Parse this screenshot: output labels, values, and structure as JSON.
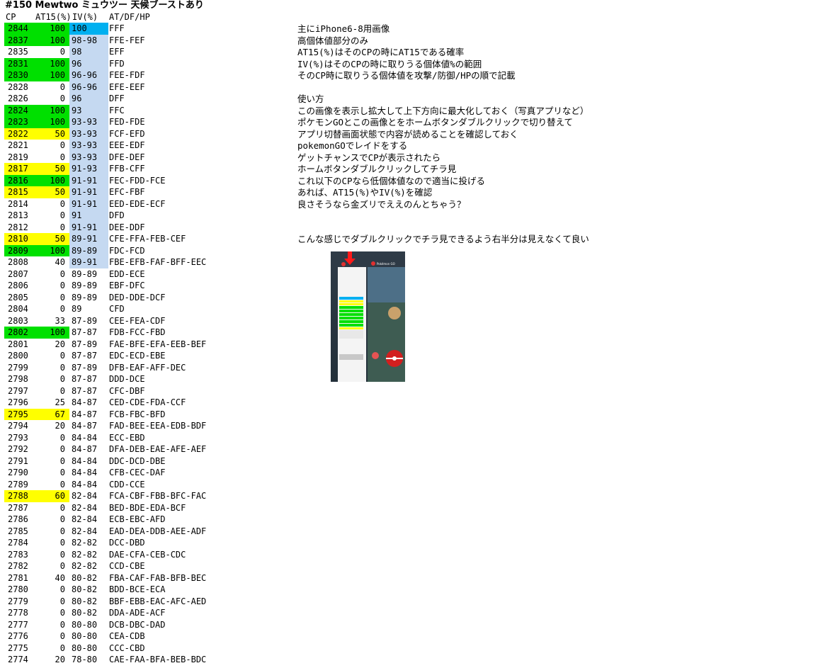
{
  "title": "#150 Mewtwo ミュウツー 天候ブーストあり",
  "headers": {
    "cp": "CP",
    "at": "AT15(%)",
    "iv": "IV(%)",
    "vals": "AT/DF/HP"
  },
  "rows": [
    {
      "cp": "2844",
      "at": "100",
      "iv": "100",
      "vals": "FFF"
    },
    {
      "cp": "2837",
      "at": "100",
      "iv": "98-98",
      "vals": "FFE-FEF"
    },
    {
      "cp": "2835",
      "at": "0",
      "iv": "98",
      "vals": "EFF"
    },
    {
      "cp": "2831",
      "at": "100",
      "iv": "96",
      "vals": "FFD"
    },
    {
      "cp": "2830",
      "at": "100",
      "iv": "96-96",
      "vals": "FEE-FDF"
    },
    {
      "cp": "2828",
      "at": "0",
      "iv": "96-96",
      "vals": "EFE-EEF"
    },
    {
      "cp": "2826",
      "at": "0",
      "iv": "96",
      "vals": "DFF"
    },
    {
      "cp": "2824",
      "at": "100",
      "iv": "93",
      "vals": "FFC"
    },
    {
      "cp": "2823",
      "at": "100",
      "iv": "93-93",
      "vals": "FED-FDE"
    },
    {
      "cp": "2822",
      "at": "50",
      "iv": "93-93",
      "vals": "FCF-EFD"
    },
    {
      "cp": "2821",
      "at": "0",
      "iv": "93-93",
      "vals": "EEE-EDF"
    },
    {
      "cp": "2819",
      "at": "0",
      "iv": "93-93",
      "vals": "DFE-DEF"
    },
    {
      "cp": "2817",
      "at": "50",
      "iv": "91-93",
      "vals": "FFB-CFF"
    },
    {
      "cp": "2816",
      "at": "100",
      "iv": "91-91",
      "vals": "FEC-FDD-FCE"
    },
    {
      "cp": "2815",
      "at": "50",
      "iv": "91-91",
      "vals": "EFC-FBF"
    },
    {
      "cp": "2814",
      "at": "0",
      "iv": "91-91",
      "vals": "EED-EDE-ECF"
    },
    {
      "cp": "2813",
      "at": "0",
      "iv": "91",
      "vals": "DFD"
    },
    {
      "cp": "2812",
      "at": "0",
      "iv": "91-91",
      "vals": "DEE-DDF"
    },
    {
      "cp": "2810",
      "at": "50",
      "iv": "89-91",
      "vals": "CFE-FFA-FEB-CEF"
    },
    {
      "cp": "2809",
      "at": "100",
      "iv": "89-89",
      "vals": "FDC-FCD"
    },
    {
      "cp": "2808",
      "at": "40",
      "iv": "89-91",
      "vals": "FBE-EFB-FAF-BFF-EEC"
    },
    {
      "cp": "2807",
      "at": "0",
      "iv": "89-89",
      "vals": "EDD-ECE"
    },
    {
      "cp": "2806",
      "at": "0",
      "iv": "89-89",
      "vals": "EBF-DFC"
    },
    {
      "cp": "2805",
      "at": "0",
      "iv": "89-89",
      "vals": "DED-DDE-DCF"
    },
    {
      "cp": "2804",
      "at": "0",
      "iv": "89",
      "vals": "CFD"
    },
    {
      "cp": "2803",
      "at": "33",
      "iv": "87-89",
      "vals": "CEE-FEA-CDF"
    },
    {
      "cp": "2802",
      "at": "100",
      "iv": "87-87",
      "vals": "FDB-FCC-FBD"
    },
    {
      "cp": "2801",
      "at": "20",
      "iv": "87-89",
      "vals": "FAE-BFE-EFA-EEB-BEF"
    },
    {
      "cp": "2800",
      "at": "0",
      "iv": "87-87",
      "vals": "EDC-ECD-EBE"
    },
    {
      "cp": "2799",
      "at": "0",
      "iv": "87-89",
      "vals": "DFB-EAF-AFF-DEC"
    },
    {
      "cp": "2798",
      "at": "0",
      "iv": "87-87",
      "vals": "DDD-DCE"
    },
    {
      "cp": "2797",
      "at": "0",
      "iv": "87-87",
      "vals": "CFC-DBF"
    },
    {
      "cp": "2796",
      "at": "25",
      "iv": "84-87",
      "vals": "CED-CDE-FDA-CCF"
    },
    {
      "cp": "2795",
      "at": "67",
      "iv": "84-87",
      "vals": "FCB-FBC-BFD"
    },
    {
      "cp": "2794",
      "at": "20",
      "iv": "84-87",
      "vals": "FAD-BEE-EEA-EDB-BDF"
    },
    {
      "cp": "2793",
      "at": "0",
      "iv": "84-84",
      "vals": "ECC-EBD"
    },
    {
      "cp": "2792",
      "at": "0",
      "iv": "84-87",
      "vals": "DFA-DEB-EAE-AFE-AEF"
    },
    {
      "cp": "2791",
      "at": "0",
      "iv": "84-84",
      "vals": "DDC-DCD-DBE"
    },
    {
      "cp": "2790",
      "at": "0",
      "iv": "84-84",
      "vals": "CFB-CEC-DAF"
    },
    {
      "cp": "2789",
      "at": "0",
      "iv": "84-84",
      "vals": "CDD-CCE"
    },
    {
      "cp": "2788",
      "at": "60",
      "iv": "82-84",
      "vals": "FCA-CBF-FBB-BFC-FAC"
    },
    {
      "cp": "2787",
      "at": "0",
      "iv": "82-84",
      "vals": "BED-BDE-EDA-BCF"
    },
    {
      "cp": "2786",
      "at": "0",
      "iv": "82-84",
      "vals": "ECB-EBC-AFD"
    },
    {
      "cp": "2785",
      "at": "0",
      "iv": "82-84",
      "vals": "EAD-DEA-DDB-AEE-ADF"
    },
    {
      "cp": "2784",
      "at": "0",
      "iv": "82-82",
      "vals": "DCC-DBD"
    },
    {
      "cp": "2783",
      "at": "0",
      "iv": "82-82",
      "vals": "DAE-CFA-CEB-CDC"
    },
    {
      "cp": "2782",
      "at": "0",
      "iv": "82-82",
      "vals": "CCD-CBE"
    },
    {
      "cp": "2781",
      "at": "40",
      "iv": "80-82",
      "vals": "FBA-CAF-FAB-BFB-BEC"
    },
    {
      "cp": "2780",
      "at": "0",
      "iv": "80-82",
      "vals": "BDD-BCE-ECA"
    },
    {
      "cp": "2779",
      "at": "0",
      "iv": "80-82",
      "vals": "BBF-EBB-EAC-AFC-AED"
    },
    {
      "cp": "2778",
      "at": "0",
      "iv": "80-82",
      "vals": "DDA-ADE-ACF"
    },
    {
      "cp": "2777",
      "at": "0",
      "iv": "80-80",
      "vals": "DCB-DBC-DAD"
    },
    {
      "cp": "2776",
      "at": "0",
      "iv": "80-80",
      "vals": "CEA-CDB"
    },
    {
      "cp": "2775",
      "at": "0",
      "iv": "80-80",
      "vals": "CCC-CBD"
    },
    {
      "cp": "2774",
      "at": "20",
      "iv": "78-80",
      "vals": "CAE-FAA-BFA-BEB-BDC"
    }
  ],
  "iv_shaded_rows": 21,
  "colors": {
    "green": "#00e000",
    "yellow": "#ffff00",
    "iv_shade": "#c5d9f1",
    "iv_top": "#00b0f0"
  },
  "notes": [
    "主にiPhone6-8用画像",
    "高個体値部分のみ",
    "AT15(%)はそのCPの時にAT15である確率",
    "IV(%)はそのCPの時に取りうる個体値%の範囲",
    "そのCP時に取りうる個体値を攻撃/防御/HPの順で記載",
    "",
    "使い方",
    "この画像を表示し拡大して上下方向に最大化しておく（写真アプリなど）",
    "ポケモンGOとこの画像とをホームボタンダブルクリックで切り替えて",
    "アプリ切替画面状態で内容が読めることを確認しておく",
    "pokemonGOでレイドをする",
    "ゲットチャンスでCPが表示されたら",
    "ホームボタンダブルクリックしてチラ見",
    "これ以下のCPなら低個体値なので適当に投げる",
    "あれば、AT15(%)やIV(%)を確認",
    "良さそうなら金ズリでええのんとちゃう？",
    "",
    "",
    "こんな感じでダブルクリックでチラ見できるよう右半分は見えなくて良い"
  ],
  "screenshot": {
    "app_label": "Pokémon GO"
  }
}
